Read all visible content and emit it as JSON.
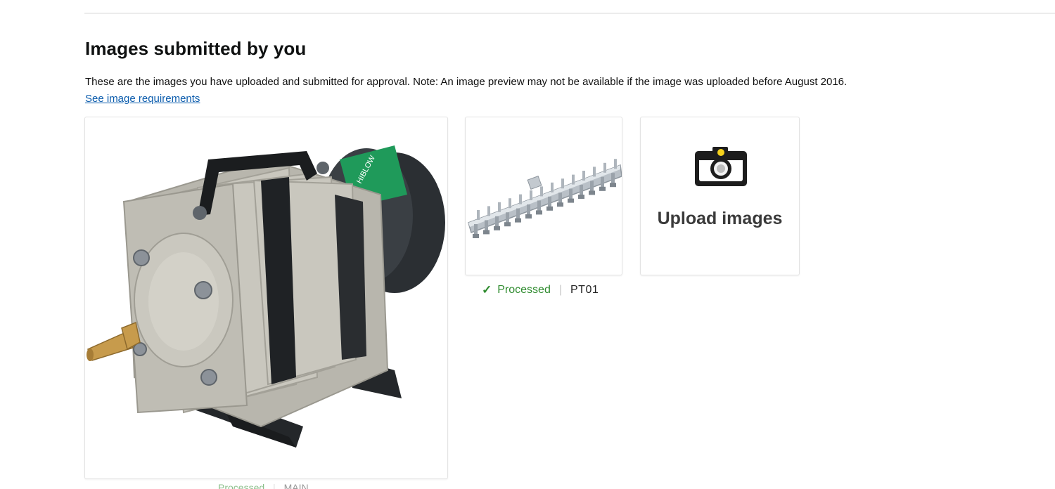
{
  "section": {
    "title": "Images submitted by you",
    "description": "These are the images you have uploaded and submitted for approval. Note: An image preview may not be available if the image was uploaded before August 2016.",
    "requirements_link": "See image requirements"
  },
  "images": [
    {
      "subject": "aquarium air pump compressor photo",
      "status": "Processed",
      "sku": "MAIN"
    },
    {
      "subject": "air manifold bar with multiple valves photo",
      "status": "Processed",
      "sku": "PT01",
      "status_icon": "checkmark-icon"
    }
  ],
  "upload_tile": {
    "label": "Upload images",
    "icon": "camera-icon"
  },
  "colors": {
    "status_green": "#2e8b2e",
    "link_blue": "#0b5cad",
    "camera_yellow": "#f6d21c"
  }
}
